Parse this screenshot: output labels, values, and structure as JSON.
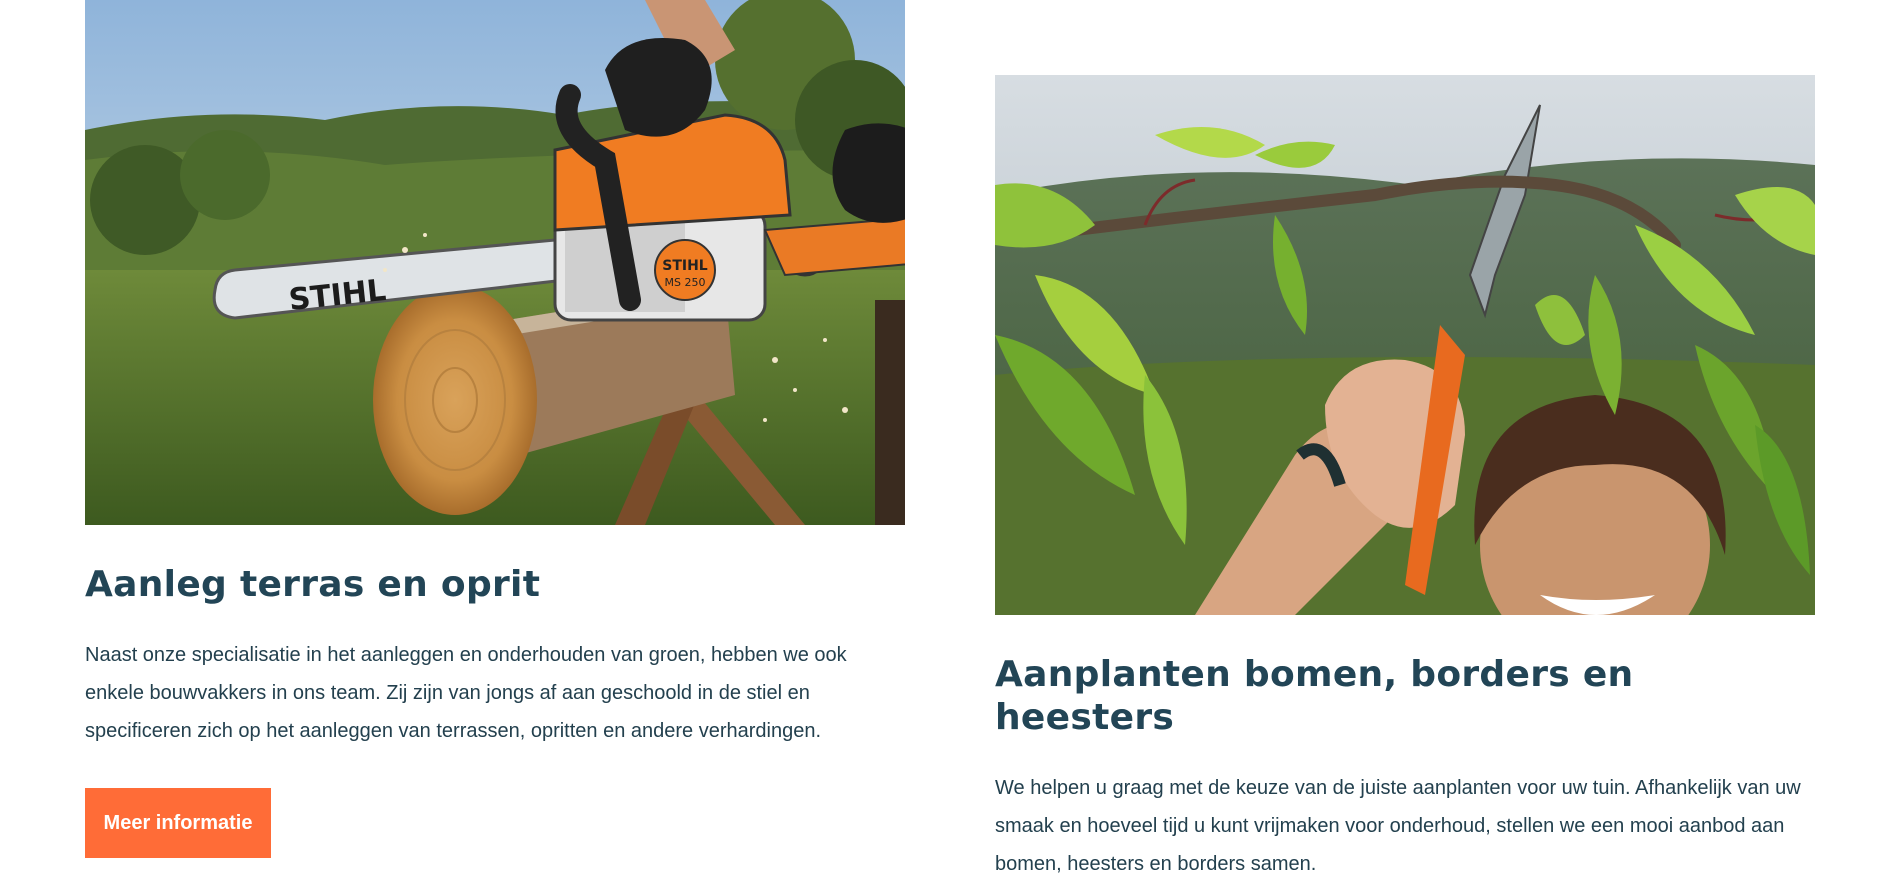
{
  "services": [
    {
      "title": "Aanleg terras en oprit",
      "description": "Naast onze specialisatie in het aanleggen en onderhouden van groen, hebben we ook enkele bouwvakkers in ons team. Zij zijn van jongs af aan geschoold in de stiel en specificeren zich op het aanleggen van terrassen, opritten en andere verhardingen.",
      "button_label": "Meer informatie",
      "chainsaw_brand": "STIHL",
      "chainsaw_model": "MS 250"
    },
    {
      "title": "Aanplanten bomen, borders en heesters",
      "description": "We helpen u graag met de keuze van de juiste aanplanten voor uw tuin. Afhankelijk van uw smaak en hoeveel tijd u kunt vrijmaken voor onderhoud, stellen we een mooi aanbod aan bomen, heesters en borders samen."
    }
  ],
  "colors": {
    "heading": "#224556",
    "text": "#23404e",
    "accent": "#ff6c37"
  }
}
